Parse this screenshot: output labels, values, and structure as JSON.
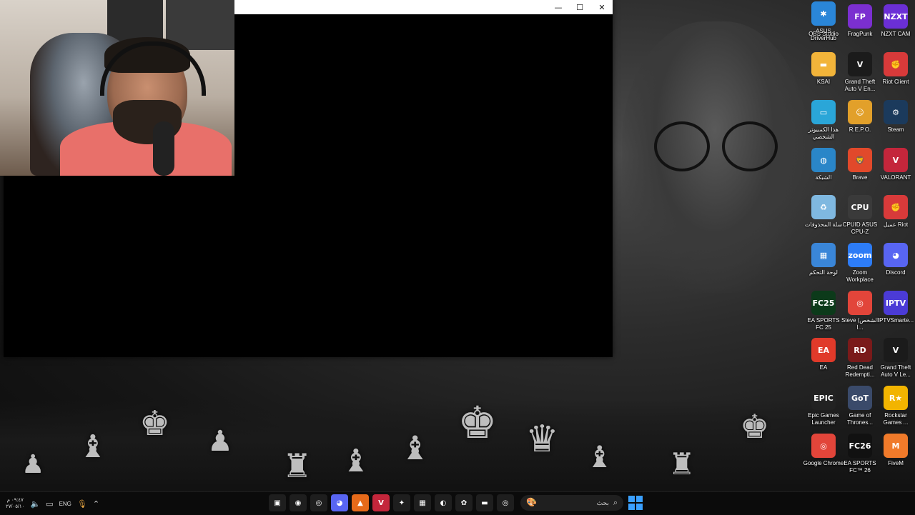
{
  "desktop": {
    "icons": [
      {
        "label": "OBS Studio",
        "glyph": "◉",
        "bg": "#2a2a2a",
        "icon": "obs-studio-icon"
      },
      {
        "label": "FragPunk",
        "glyph": "FP",
        "bg": "#7b2fd0",
        "icon": "fragpunk-icon"
      },
      {
        "label": "NZXT CAM",
        "glyph": "NZXT",
        "bg": "#6b2fd6",
        "icon": "nzxt-cam-icon"
      },
      {
        "label": "KSAI",
        "glyph": "▬",
        "bg": "#f2b43a",
        "icon": "folder-icon"
      },
      {
        "label": "Grand Theft Auto V En...",
        "glyph": "V",
        "bg": "#1b1b1b",
        "icon": "gta-v-enhanced-icon"
      },
      {
        "label": "Riot Client",
        "glyph": "✊",
        "bg": "#d83a3a",
        "icon": "riot-client-icon"
      },
      {
        "label": "هذا الكمبيوتر الشخصي",
        "glyph": "▭",
        "bg": "#2aa6d8",
        "icon": "this-pc-icon"
      },
      {
        "label": "R.E.P.O.",
        "glyph": "☺",
        "bg": "#e2a02a",
        "icon": "repo-game-icon"
      },
      {
        "label": "Steam",
        "glyph": "⚙",
        "bg": "#1b3a5c",
        "icon": "steam-icon"
      },
      {
        "label": "الشبكة",
        "glyph": "◍",
        "bg": "#2a86c8",
        "icon": "network-icon"
      },
      {
        "label": "Brave",
        "glyph": "🦁",
        "bg": "#e1492b",
        "icon": "brave-icon"
      },
      {
        "label": "VALORANT",
        "glyph": "V",
        "bg": "#c4263b",
        "icon": "valorant-icon"
      },
      {
        "label": "سلة المحذوفات",
        "glyph": "♻",
        "bg": "#7fb8e0",
        "icon": "recycle-bin-icon"
      },
      {
        "label": "CPUID ASUS CPU-Z",
        "glyph": "CPU",
        "bg": "#3a3a3a",
        "icon": "cpu-z-icon"
      },
      {
        "label": "عميل Riot",
        "glyph": "✊",
        "bg": "#d83a3a",
        "icon": "riot-client-ar-icon"
      },
      {
        "label": "لوحة التحكم",
        "glyph": "▦",
        "bg": "#3a86d8",
        "icon": "control-panel-icon"
      },
      {
        "label": "Zoom Workplace",
        "glyph": "zoom",
        "bg": "#2d7cf6",
        "icon": "zoom-icon"
      },
      {
        "label": "Discord",
        "glyph": "◕",
        "bg": "#5865f2",
        "icon": "discord-icon"
      },
      {
        "label": "EA SPORTS FC 25",
        "glyph": "FC25",
        "bg": "#0c3a1a",
        "icon": "ea-fc25-icon"
      },
      {
        "label": "Steve (الشخص ا...",
        "glyph": "◎",
        "bg": "#e2453a",
        "icon": "chrome-profile-icon"
      },
      {
        "label": "IPTVSmarte...",
        "glyph": "IPTV",
        "bg": "#4b3bd6",
        "icon": "iptv-smarters-icon"
      },
      {
        "label": "EA",
        "glyph": "EA",
        "bg": "#e03a2a",
        "icon": "ea-app-icon"
      },
      {
        "label": "Red Dead Redempti...",
        "glyph": "RD",
        "bg": "#7a1a1a",
        "icon": "red-dead-icon"
      },
      {
        "label": "Grand Theft Auto V Le...",
        "glyph": "V",
        "bg": "#1b1b1b",
        "icon": "gta-v-legacy-icon"
      },
      {
        "label": "Epic Games Launcher",
        "glyph": "EPIC",
        "bg": "#222",
        "icon": "epic-games-icon"
      },
      {
        "label": "Game of Thrones...",
        "glyph": "GoT",
        "bg": "#3a4a6a",
        "icon": "game-of-thrones-icon"
      },
      {
        "label": "Rockstar Games ...",
        "glyph": "R★",
        "bg": "#f2b400",
        "icon": "rockstar-icon"
      },
      {
        "label": "Google Chrome",
        "glyph": "◎",
        "bg": "#e2453a",
        "icon": "google-chrome-icon"
      },
      {
        "label": "EA SPORTS FC™ 26",
        "glyph": "FC26",
        "bg": "#111",
        "icon": "ea-fc26-icon"
      },
      {
        "label": "FiveM",
        "glyph": "M",
        "bg": "#f07a2a",
        "icon": "fivem-icon"
      },
      {
        "label": "ASUS DriverHub",
        "glyph": "✱",
        "bg": "#2a86d8",
        "icon": "asus-driverhub-icon"
      }
    ]
  },
  "window": {
    "minimize": "—",
    "maximize": "☐",
    "close": "✕"
  },
  "taskbar": {
    "time": "٠٩:٤٧ م",
    "date": "٢٧/٠٥/١٠",
    "language": "ENG",
    "search_placeholder": "بحث",
    "apps": [
      {
        "icon": "pinned-app-1-icon",
        "glyph": "▣",
        "bg": "#1e1e1e"
      },
      {
        "icon": "obs-taskbar-icon",
        "glyph": "◉",
        "bg": "#1e1e1e"
      },
      {
        "icon": "chrome-taskbar-icon",
        "glyph": "◎",
        "bg": "#1e1e1e"
      },
      {
        "icon": "discord-taskbar-icon",
        "glyph": "◕",
        "bg": "#5865f2"
      },
      {
        "icon": "vlc-taskbar-icon",
        "glyph": "▲",
        "bg": "#e66a1a"
      },
      {
        "icon": "valorant-taskbar-icon",
        "glyph": "V",
        "bg": "#c4263b"
      },
      {
        "icon": "razer-taskbar-icon",
        "glyph": "✦",
        "bg": "#1e1e1e"
      },
      {
        "icon": "store-taskbar-icon",
        "glyph": "▦",
        "bg": "#1e1e1e"
      },
      {
        "icon": "edge-taskbar-icon",
        "glyph": "◐",
        "bg": "#1e1e1e"
      },
      {
        "icon": "copilot-taskbar-icon",
        "glyph": "✿",
        "bg": "#1e1e1e"
      },
      {
        "icon": "file-explorer-icon",
        "glyph": "▬",
        "bg": "#1e1e1e"
      },
      {
        "icon": "chrome-2-taskbar-icon",
        "glyph": "◎",
        "bg": "#1e1e1e"
      }
    ]
  }
}
